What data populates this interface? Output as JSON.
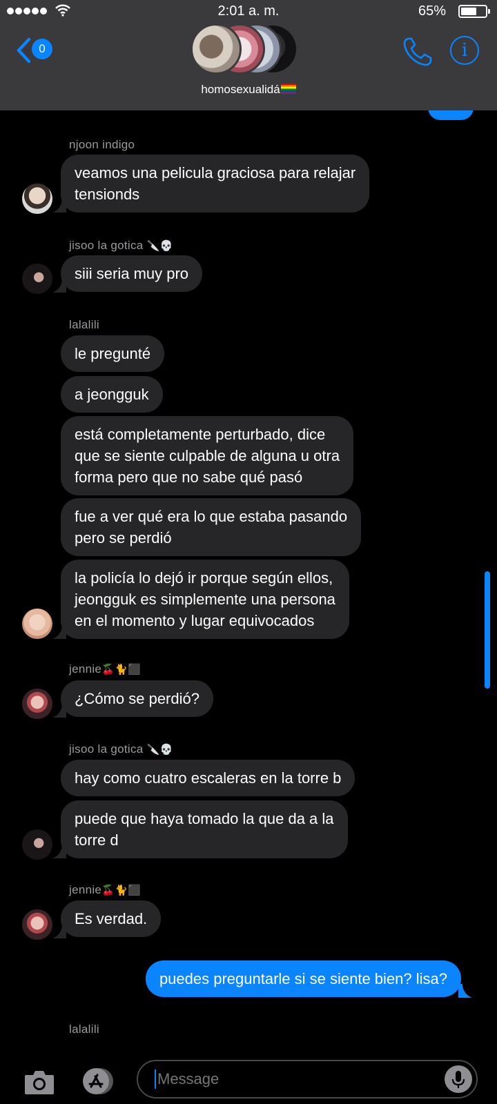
{
  "status_bar": {
    "time": "2:01 a. m.",
    "battery_pct": "65%",
    "battery_level": 0.65
  },
  "header": {
    "back_badge": "0",
    "group_name": "homosexualidá"
  },
  "composer": {
    "placeholder": "Message"
  },
  "messages": [
    {
      "sender": "njoon indigo",
      "sender_emoji": "",
      "texts": [
        "veamos una pelicula graciosa para relajar\ntensionds"
      ]
    },
    {
      "sender": "jisoo la gotica",
      "sender_emoji": "🔪💀",
      "texts": [
        "siii seria muy pro"
      ]
    },
    {
      "sender": "lalalili",
      "sender_emoji": "",
      "texts": [
        "le pregunté",
        "a jeongguk",
        "está completamente perturbado, dice\nque se siente culpable de alguna u otra\nforma pero que no sabe qué pasó",
        "fue a ver qué era lo que estaba pasando\npero se perdió",
        "la policía lo dejó ir porque según ellos,\njeongguk es simplemente una persona\nen el momento y lugar equivocados"
      ]
    },
    {
      "sender": "jennie",
      "sender_emoji": "🍒🐈⬛",
      "texts": [
        "¿Cómo se perdió?"
      ]
    },
    {
      "sender": "jisoo la gotica",
      "sender_emoji": "🔪💀",
      "texts": [
        "hay como cuatro escaleras en la torre b",
        "puede que haya tomado la que da a la\ntorre d"
      ]
    },
    {
      "sender": "jennie",
      "sender_emoji": "🍒🐈⬛",
      "texts": [
        "Es verdad."
      ]
    },
    {
      "sender": "me",
      "outgoing": true,
      "texts": [
        "puedes preguntarle si se siente bien? lisa?"
      ]
    },
    {
      "sender": "lalalili",
      "sender_emoji": "",
      "texts": []
    }
  ],
  "colors": {
    "accent": "#0a84ff",
    "incoming_bubble": "#262628",
    "header_bg": "#3a3a3c"
  }
}
